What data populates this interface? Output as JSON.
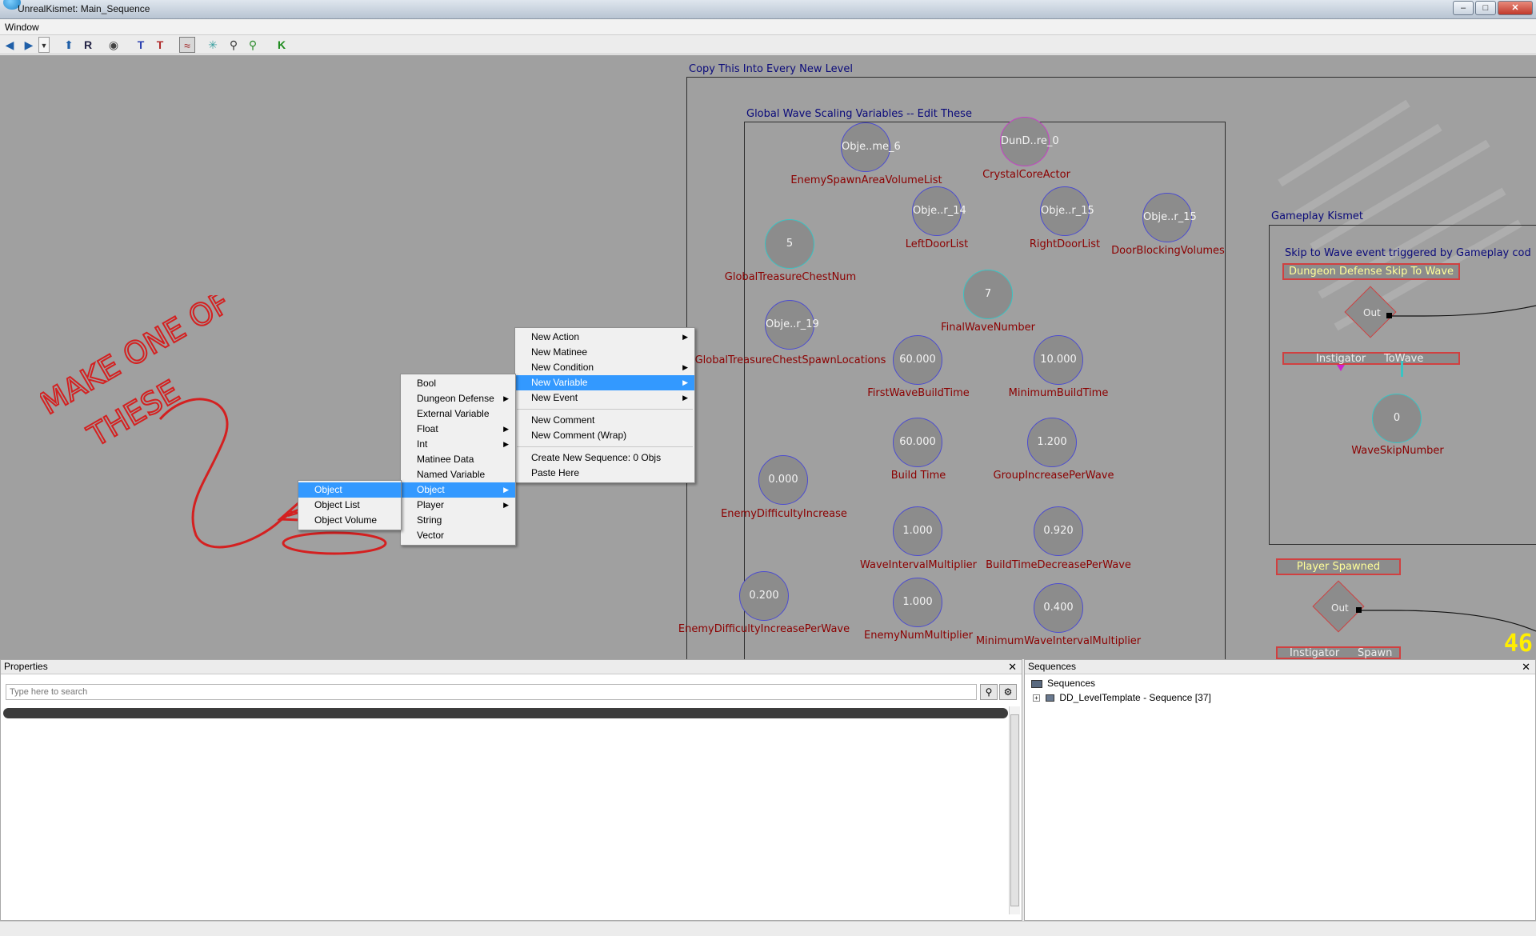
{
  "window": {
    "title": "UnrealKismet: Main_Sequence",
    "minimize": "–",
    "maximize": "□",
    "close": "✕"
  },
  "menubar": {
    "window_label": "Window"
  },
  "toolbar": {
    "icons": [
      "back-arrow-icon",
      "forward-arrow-icon",
      "dropdown-icon",
      "parent-sequence-icon",
      "rename-icon",
      "eye-icon",
      "top-link-icon",
      "bottom-link-icon",
      "curve-icon",
      "bulb-icon",
      "zoom-icon",
      "search-icon",
      "kismet-k-icon"
    ]
  },
  "canvas": {
    "outer_comment": "Copy This Into Every New Level",
    "inner_comment": "Global Wave Scaling Variables -- Edit These",
    "gameplay_comment": "Gameplay Kismet",
    "skip_comment": "Skip to Wave event triggered by Gameplay cod",
    "frame_counter": "46",
    "annotation": {
      "line1": "MAKE ONE OF",
      "line2": "THESE"
    },
    "variables": [
      {
        "value": "Obje..me_6",
        "label": "EnemySpawnAreaVolumeList"
      },
      {
        "value": "DunD..re_0",
        "label": "CrystalCoreActor"
      },
      {
        "value": "Obje..r_14",
        "label": "LeftDoorList"
      },
      {
        "value": "Obje..r_15",
        "label": "RightDoorList"
      },
      {
        "value": "Obje..r_15",
        "label": "DoorBlockingVolumes"
      },
      {
        "value": "5",
        "label": "GlobalTreasureChestNum"
      },
      {
        "value": "7",
        "label": "FinalWaveNumber"
      },
      {
        "value": "Obje..r_19",
        "label": "GlobalTreasureChestSpawnLocations"
      },
      {
        "value": "60.000",
        "label": "FirstWaveBuildTime"
      },
      {
        "value": "10.000",
        "label": "MinimumBuildTime"
      },
      {
        "value": "60.000",
        "label": "Build Time"
      },
      {
        "value": "1.200",
        "label": "GroupIncreasePerWave"
      },
      {
        "value": "0.000",
        "label": "EnemyDifficultyIncrease"
      },
      {
        "value": "1.000",
        "label": "WaveIntervalMultiplier"
      },
      {
        "value": "0.920",
        "label": "BuildTimeDecreasePerWave"
      },
      {
        "value": "0.200",
        "label": "EnemyDifficultyIncreasePerWave"
      },
      {
        "value": "1.000",
        "label": "EnemyNumMultiplier"
      },
      {
        "value": "0.400",
        "label": "MinimumWaveIntervalMultiplier"
      },
      {
        "value": "0",
        "label": "WaveSkipNumber"
      }
    ],
    "events": {
      "skip_wave": {
        "title": "Dungeon Defense Skip To Wave",
        "out": "Out",
        "link1": "Instigator",
        "link2": "ToWave"
      },
      "player_spawned": {
        "title": "Player Spawned",
        "out": "Out",
        "link1": "Instigator",
        "link2": "Spawn"
      }
    }
  },
  "context_menu_main": {
    "items": [
      {
        "label": "New Action",
        "submenu": true
      },
      {
        "label": "New Matinee",
        "submenu": false
      },
      {
        "label": "New Condition",
        "submenu": true
      },
      {
        "label": "New Variable",
        "submenu": true,
        "highlighted": true
      },
      {
        "label": "New Event",
        "submenu": true
      }
    ],
    "items2": [
      {
        "label": "New Comment"
      },
      {
        "label": "New Comment (Wrap)"
      }
    ],
    "items3": [
      {
        "label": "Create New Sequence: 0 Objs"
      },
      {
        "label": "Paste Here"
      }
    ]
  },
  "context_menu_variable": {
    "items": [
      {
        "label": "Bool",
        "submenu": false
      },
      {
        "label": "Dungeon Defense",
        "submenu": true
      },
      {
        "label": "External Variable",
        "submenu": false
      },
      {
        "label": "Float",
        "submenu": true
      },
      {
        "label": "Int",
        "submenu": true
      },
      {
        "label": "Matinee Data",
        "submenu": false
      },
      {
        "label": "Named Variable",
        "submenu": false
      },
      {
        "label": "Object",
        "submenu": true,
        "highlighted": true
      },
      {
        "label": "Player",
        "submenu": true
      },
      {
        "label": "String",
        "submenu": false
      },
      {
        "label": "Vector",
        "submenu": false
      }
    ]
  },
  "context_menu_object": {
    "items": [
      {
        "label": "Object",
        "highlighted": true
      },
      {
        "label": "Object List"
      },
      {
        "label": "Object Volume"
      }
    ]
  },
  "properties_panel": {
    "title": "Properties",
    "close": "✕",
    "search_placeholder": "Type here to search"
  },
  "sequences_panel": {
    "title": "Sequences",
    "close": "✕",
    "root": "Sequences",
    "child": "DD_LevelTemplate - Sequence [37]",
    "expander": "+"
  },
  "colors": {
    "canvas_bg": "#a0a0a0",
    "menu_highlight": "#3399ff",
    "var_label": "#8b0000",
    "comment_text": "#0a0a7a",
    "annotation_red": "#d42020"
  }
}
